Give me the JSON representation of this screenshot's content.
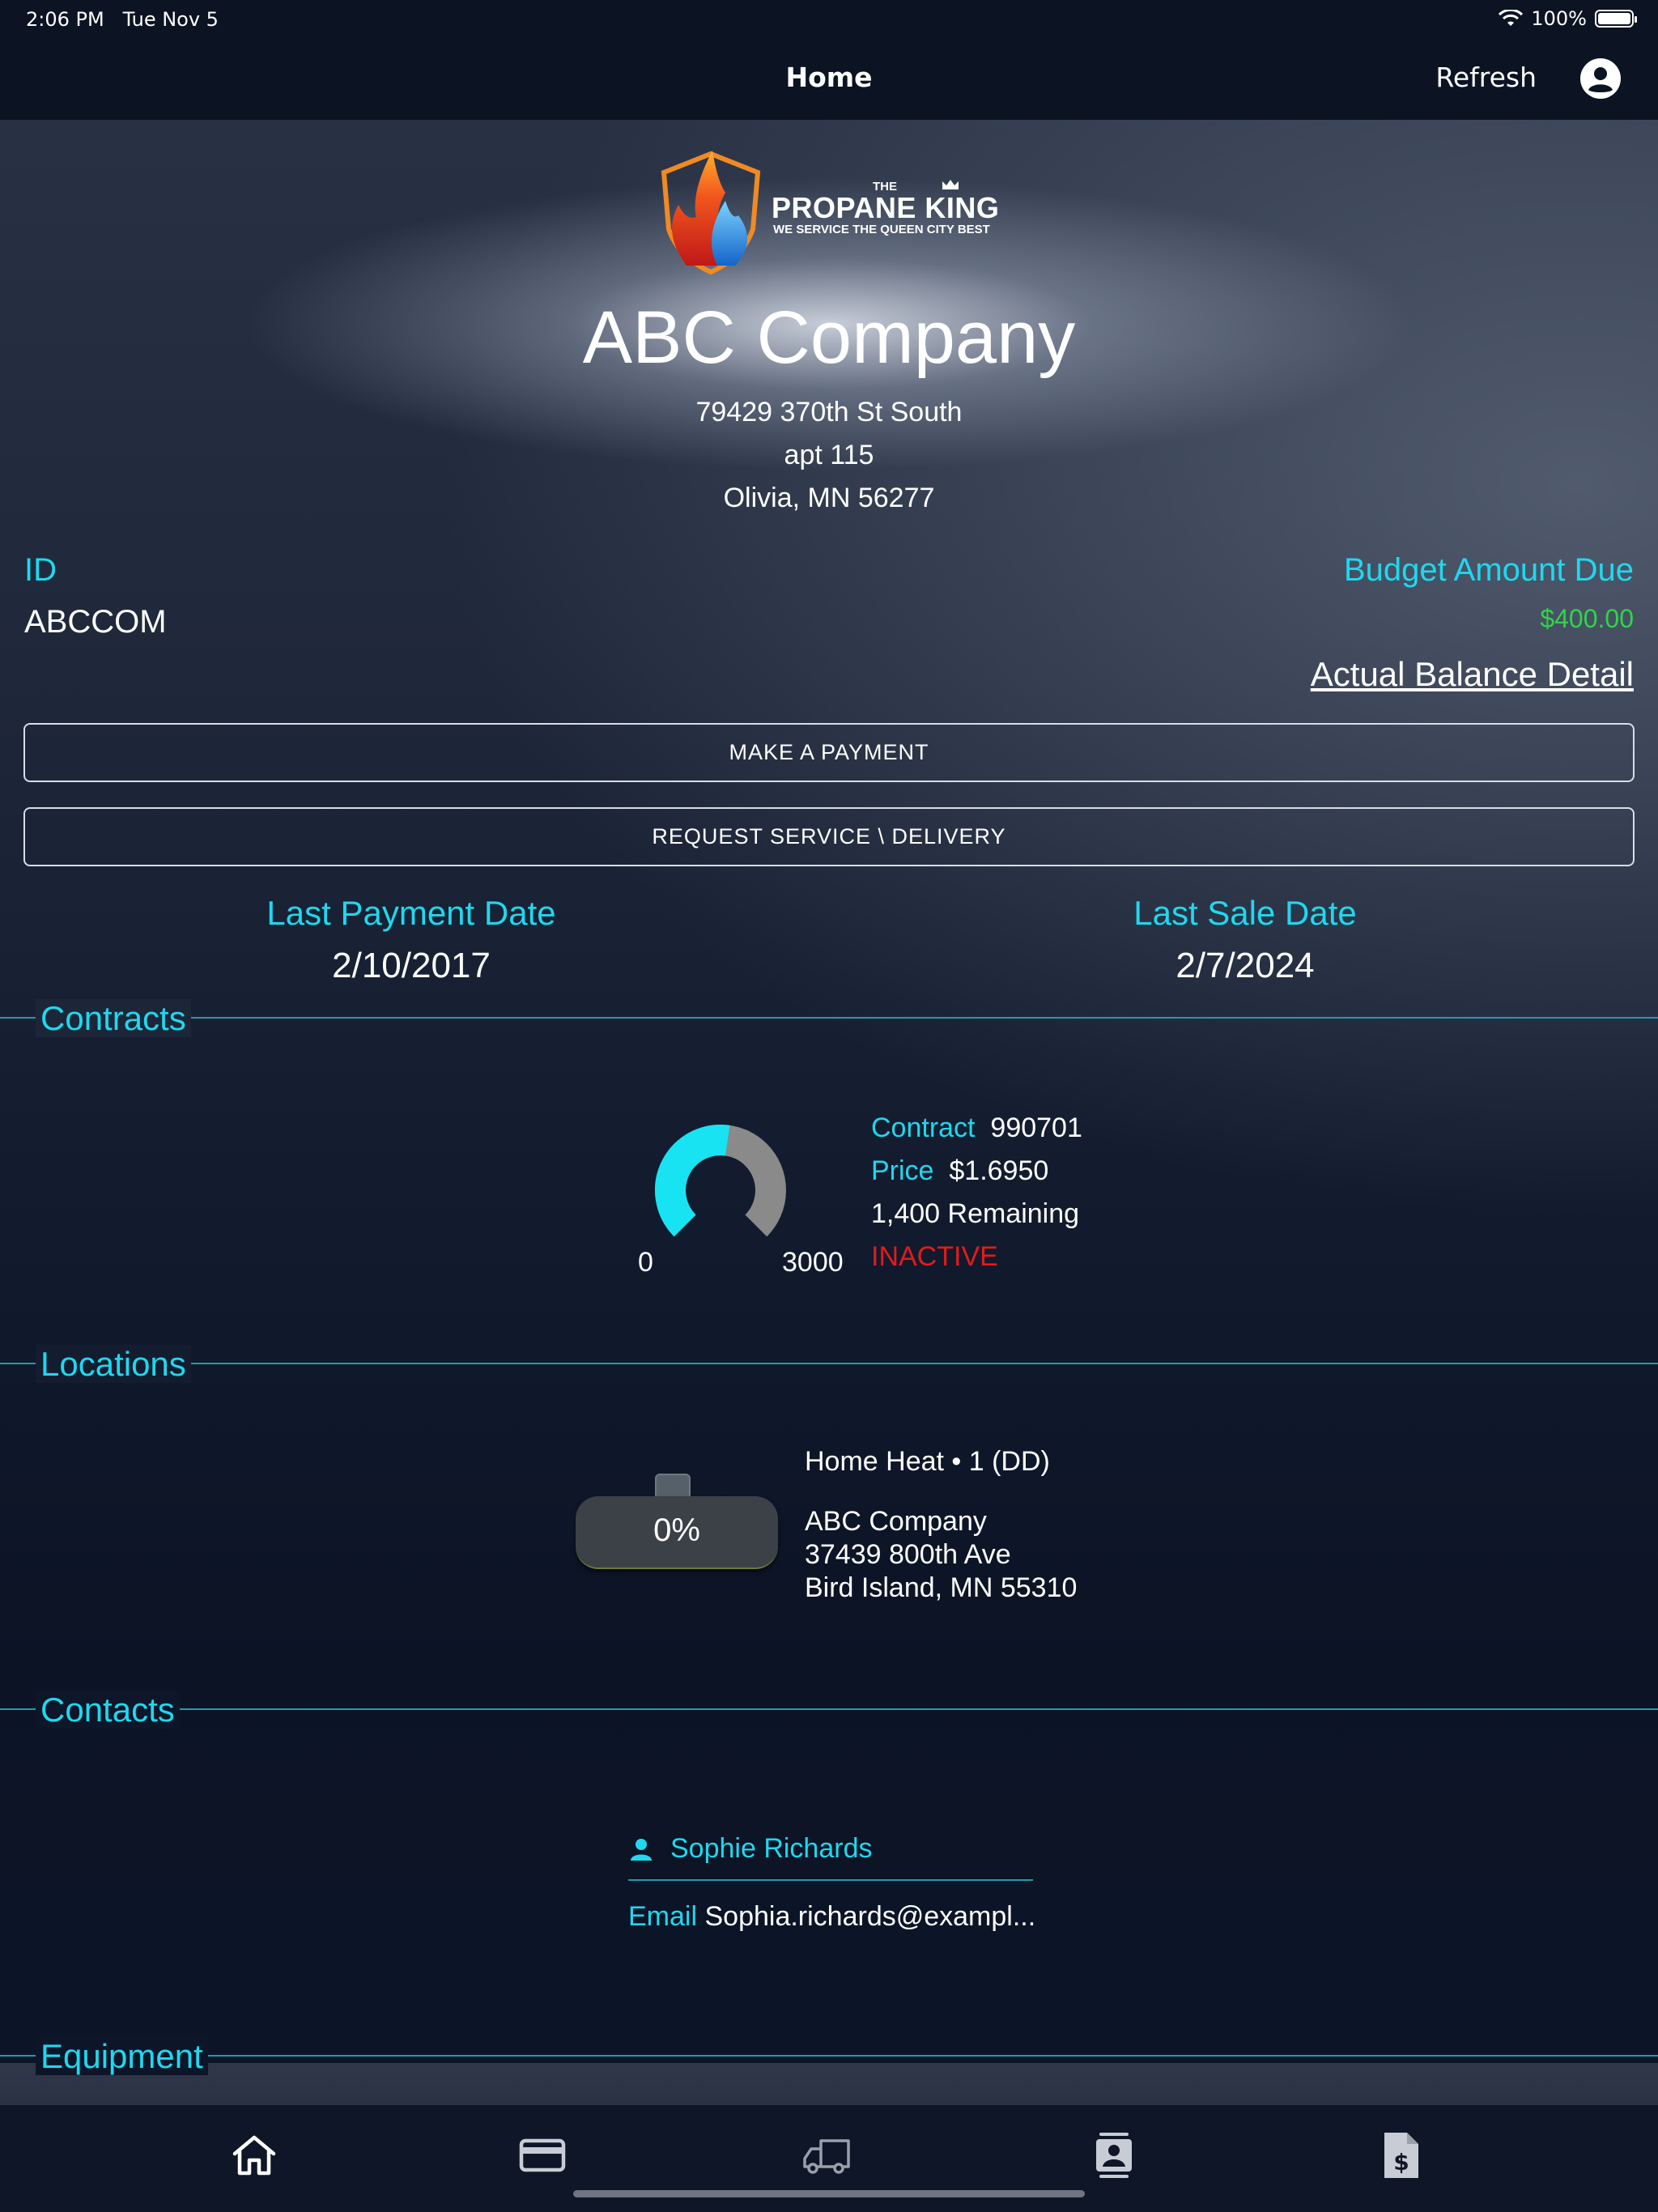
{
  "status_bar": {
    "time": "2:06 PM",
    "date": "Tue Nov 5",
    "battery": "100%"
  },
  "nav": {
    "title": "Home",
    "refresh_label": "Refresh",
    "account_icon": "account-circle-icon"
  },
  "logo": {
    "the": "THE",
    "name": "PROPANE KING",
    "tagline": "WE SERVICE THE QUEEN CITY BEST"
  },
  "company": {
    "name": "ABC Company",
    "address_line1": "79429 370th St South",
    "address_line2": "apt 115",
    "address_line3": "Olivia, MN 56277"
  },
  "account": {
    "id_label": "ID",
    "id_value": "ABCCOM",
    "budget_label": "Budget Amount Due",
    "budget_value": "$400.00",
    "balance_link": "Actual Balance Detail"
  },
  "buttons": {
    "payment": "MAKE A PAYMENT",
    "service": "REQUEST SERVICE \\ DELIVERY"
  },
  "dates": {
    "last_payment_label": "Last Payment Date",
    "last_payment_value": "2/10/2017",
    "last_sale_label": "Last Sale Date",
    "last_sale_value": "2/7/2024"
  },
  "sections": {
    "contracts": "Contracts",
    "locations": "Locations",
    "contacts": "Contacts",
    "equipment": "Equipment"
  },
  "contract": {
    "contract_label": "Contract",
    "contract_value": "990701",
    "price_label": "Price",
    "price_value": "$1.6950",
    "remaining": "1,400 Remaining",
    "status": "INACTIVE",
    "gauge_min": "0",
    "gauge_max": "3000",
    "gauge_fill_fraction": 0.53
  },
  "location": {
    "tank_percent": "0%",
    "title": "Home Heat • 1 (DD)",
    "name": "ABC Company",
    "street": "37439 800th Ave",
    "city": "Bird Island, MN  55310"
  },
  "contact": {
    "name": "Sophie Richards",
    "email_label": "Email",
    "email_value": "Sophia.richards@exampl..."
  },
  "colors": {
    "accent": "#1fd8ee",
    "amount": "#2fd44a",
    "inactive": "#e21b1b"
  },
  "tabs": [
    {
      "icon": "home-icon",
      "active": true
    },
    {
      "icon": "credit-card-icon",
      "active": false
    },
    {
      "icon": "delivery-truck-icon",
      "active": false
    },
    {
      "icon": "contacts-icon",
      "active": false
    },
    {
      "icon": "invoice-dollar-icon",
      "active": false
    }
  ]
}
